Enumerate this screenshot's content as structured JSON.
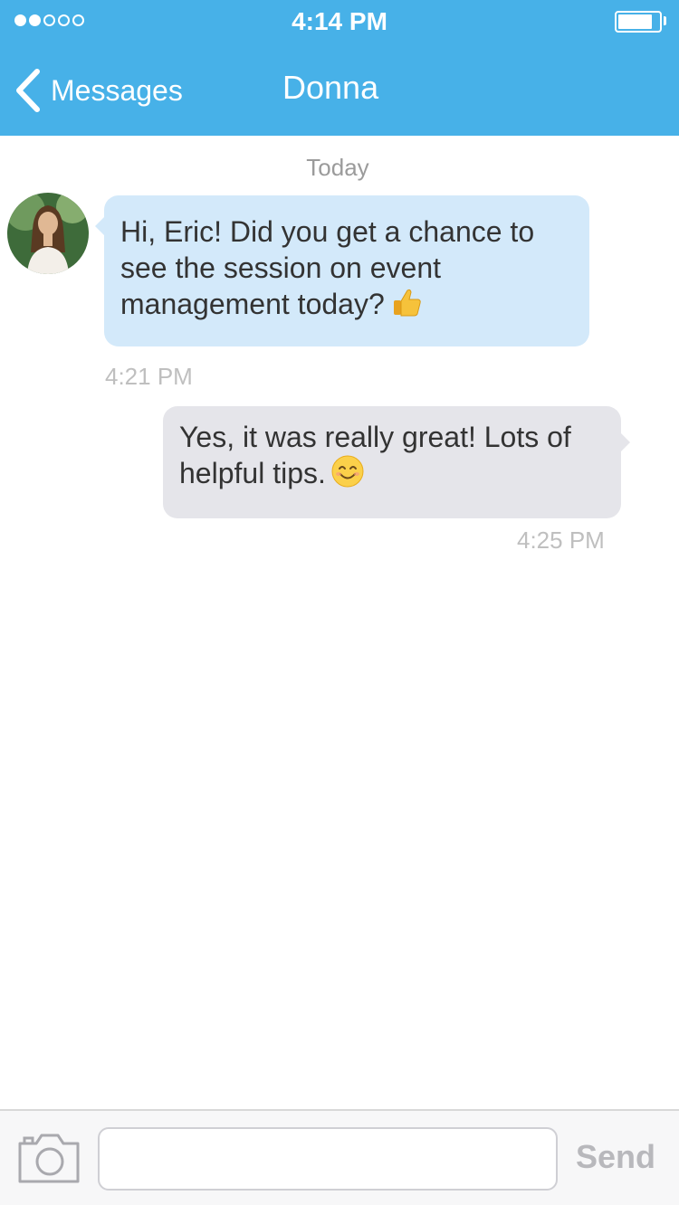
{
  "status_bar": {
    "signal_bars_filled": 2,
    "signal_bars_total": 5,
    "time": "4:14 PM",
    "battery_level": 0.85
  },
  "nav": {
    "back_label": "Messages",
    "title": "Donna"
  },
  "conversation": {
    "day_label": "Today",
    "messages": [
      {
        "direction": "incoming",
        "sender": "Donna",
        "text": "Hi, Eric! Did you get a chance to see the session on event management today?",
        "emoji": "thumbs-up-icon",
        "time": "4:21 PM"
      },
      {
        "direction": "outgoing",
        "text": "Yes, it was really great! Lots of helpful tips.",
        "emoji": "smiling-face-icon",
        "time": "4:25 PM"
      }
    ]
  },
  "composer": {
    "input_value": "",
    "send_label": "Send",
    "camera_icon": "camera-icon"
  },
  "colors": {
    "header_bg": "#47b1e8",
    "incoming_bubble": "#d3e9fa",
    "outgoing_bubble": "#e5e5ea",
    "send_disabled": "#b8b8bc"
  }
}
